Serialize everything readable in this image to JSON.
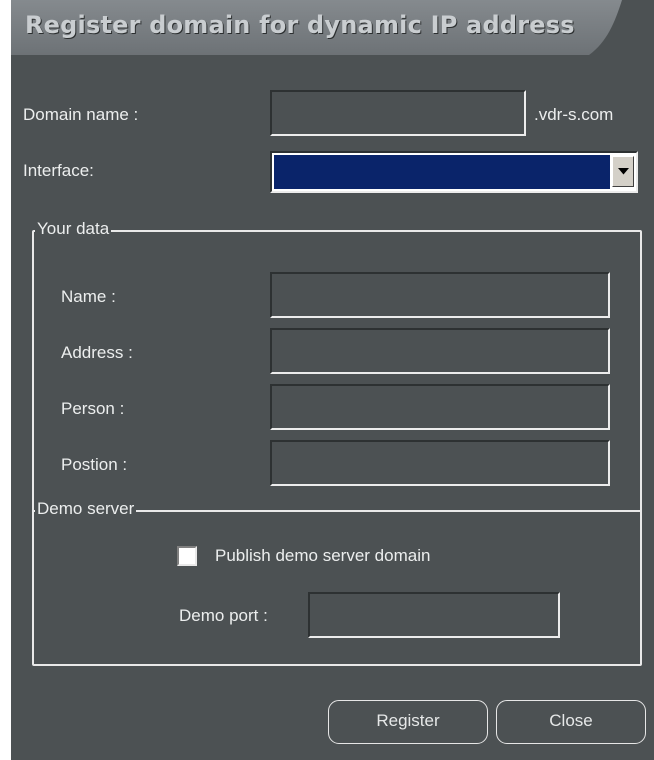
{
  "dialog": {
    "title": "Register domain for dynamic IP address"
  },
  "domain": {
    "label": "Domain name :",
    "value": "",
    "suffix": ".vdr-s.com"
  },
  "interface": {
    "label": "Interface:",
    "selected": ""
  },
  "your_data": {
    "legend": "Your data",
    "fields": [
      {
        "label": "Name :",
        "value": ""
      },
      {
        "label": "Address :",
        "value": ""
      },
      {
        "label": "Person :",
        "value": ""
      },
      {
        "label": "Postion :",
        "value": ""
      }
    ]
  },
  "demo_server": {
    "legend": "Demo server",
    "publish_label": "Publish demo server domain",
    "publish_checked": false,
    "port_label": "Demo port :",
    "port_value": ""
  },
  "buttons": {
    "register": "Register",
    "close": "Close"
  },
  "colors": {
    "background": "#4c5153",
    "title_tab": "#777c80",
    "selection": "#0a246a",
    "text": "#eceeee"
  },
  "icons": {
    "dropdown": "chevron-down-icon"
  }
}
